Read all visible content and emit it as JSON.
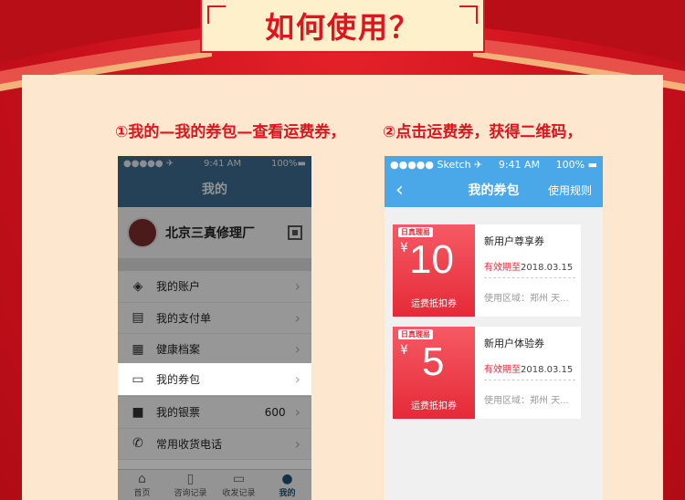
{
  "title": "如何使用？",
  "steps": {
    "step1": "①我的—我的券包—查看运费券，",
    "step2": "②点击运费券，获得二维码，"
  },
  "phone1": {
    "status": {
      "carrier": "●●●●● ✈",
      "time": "9:41 AM",
      "battery": "100%▬"
    },
    "nav_title": "我的",
    "profile_name": "北京三真修理厂",
    "menu": [
      {
        "icon": "wallet-icon",
        "glyph": "◈",
        "label": "我的账户",
        "value": ""
      },
      {
        "icon": "bill-icon",
        "glyph": "▤",
        "label": "我的支付单",
        "value": ""
      },
      {
        "icon": "health-file-icon",
        "glyph": "▦",
        "label": "健康档案",
        "value": ""
      },
      {
        "icon": "coupon-icon",
        "glyph": "▭",
        "label": "我的券包",
        "value": ""
      },
      {
        "icon": "silver-ticket-icon",
        "glyph": "■",
        "label": "我的银票",
        "value": "600"
      },
      {
        "icon": "phone-icon",
        "glyph": "✆",
        "label": "常用收货电话",
        "value": ""
      }
    ],
    "tabs": [
      {
        "icon": "home-icon",
        "glyph": "⌂",
        "label": "首页"
      },
      {
        "icon": "consult-record-icon",
        "glyph": "▯",
        "label": "咨询记录"
      },
      {
        "icon": "shipping-record-icon",
        "glyph": "▭",
        "label": "收发记录"
      },
      {
        "icon": "mine-icon",
        "glyph": "●",
        "label": "我的"
      }
    ]
  },
  "phone2": {
    "status": {
      "carrier": "●●●●● Sketch ✈",
      "time": "9:41 AM",
      "battery": "100% ▬"
    },
    "back": "‹",
    "nav_title": "我的券包",
    "nav_right": "使用规则",
    "coupons": [
      {
        "brand": "日真理易",
        "yen": "¥",
        "amount": "10",
        "type": "运费抵扣券",
        "name": "新用户尊享券",
        "exp_label": "有效期至",
        "exp_date": "2018.03.15",
        "area": "使用区域：郑州 天..."
      },
      {
        "brand": "日真理易",
        "yen": "¥",
        "amount": "5",
        "type": "运费抵扣券",
        "name": "新用户体验券",
        "exp_label": "有效期至",
        "exp_date": "2018.03.15",
        "area": "使用区域：郑州 天..."
      }
    ]
  },
  "colors": {
    "brand_red": "#e0141e",
    "wall": "#fde8cf",
    "phone1_nav": "#3a6a8e",
    "phone2_nav": "#4aa8e8"
  }
}
